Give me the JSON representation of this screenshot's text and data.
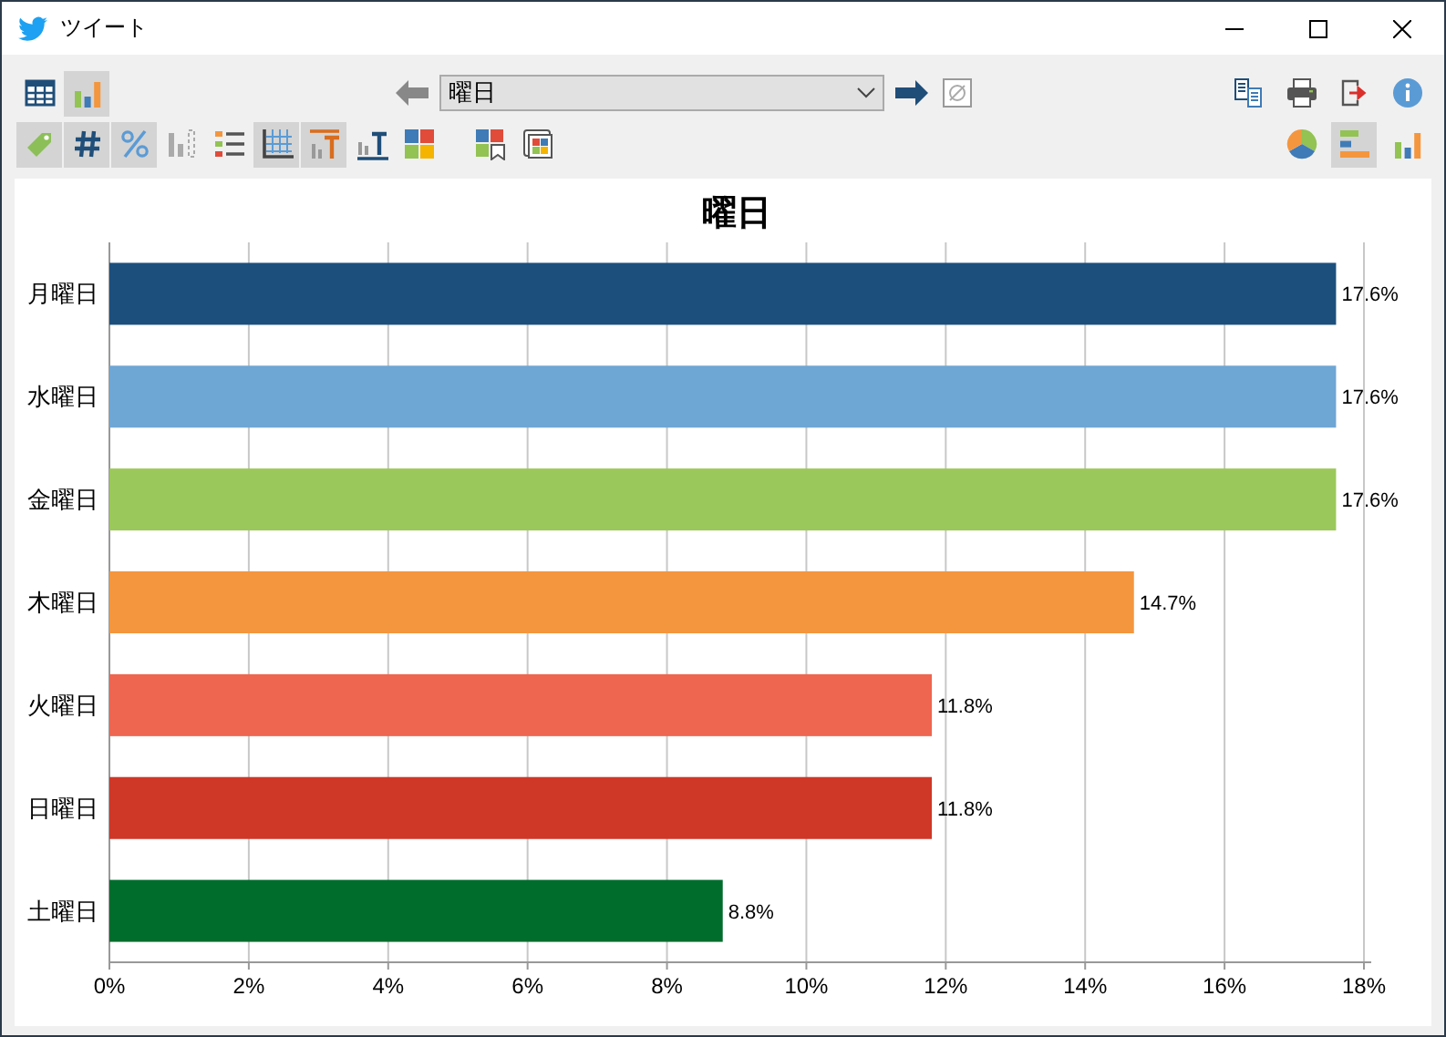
{
  "window": {
    "title": "ツイート"
  },
  "toolbar_top_left": [
    {
      "kind": "table",
      "selected": false
    },
    {
      "kind": "columns",
      "selected": true
    }
  ],
  "navigator": {
    "value": "曜日",
    "next_enabled": true,
    "prev_enabled": false
  },
  "toolbar_top_right": [
    {
      "kind": "copy",
      "selected": false
    },
    {
      "kind": "print",
      "selected": false
    },
    {
      "kind": "export",
      "selected": false
    },
    {
      "kind": "info",
      "selected": false
    }
  ],
  "toolbar_bottom_left": [
    {
      "kind": "tag",
      "selected": true
    },
    {
      "kind": "hash",
      "selected": true
    },
    {
      "kind": "percent",
      "selected": true
    },
    {
      "kind": "hidden",
      "selected": false
    },
    {
      "kind": "legend",
      "selected": false
    },
    {
      "kind": "grid",
      "selected": true
    },
    {
      "kind": "toplabel",
      "selected": true
    },
    {
      "kind": "axislabel",
      "selected": false
    },
    {
      "kind": "palette",
      "selected": false
    }
  ],
  "toolbar_bottom_palette": [
    {
      "kind": "palettemark",
      "selected": false
    },
    {
      "kind": "palettewin",
      "selected": false
    }
  ],
  "toolbar_bottom_right": [
    {
      "kind": "pie",
      "selected": false
    },
    {
      "kind": "hbar",
      "selected": true
    },
    {
      "kind": "columns",
      "selected": false
    }
  ],
  "chart": {
    "chart_data": {
      "type": "bar",
      "orientation": "horizontal",
      "title": "曜日",
      "categories": [
        "月曜日",
        "水曜日",
        "金曜日",
        "木曜日",
        "火曜日",
        "日曜日",
        "土曜日"
      ],
      "colors": [
        "#1c4f7c",
        "#6ea6d4",
        "#9bc85a",
        "#f4963e",
        "#ee6550",
        "#cf3727",
        "#016d2c"
      ],
      "values": [
        17.6,
        17.6,
        17.6,
        14.7,
        11.8,
        11.8,
        8.8
      ],
      "grid": true,
      "value_labels": [
        "17.6%",
        "17.6%",
        "17.6%",
        "14.7%",
        "11.8%",
        "11.8%",
        "8.8%"
      ],
      "xlim": [
        0,
        18
      ],
      "xticks": [
        {
          "value": 0,
          "label": "0%"
        },
        {
          "value": 2,
          "label": "2%"
        },
        {
          "value": 4,
          "label": "4%"
        },
        {
          "value": 6,
          "label": "6%"
        },
        {
          "value": 8,
          "label": "8%"
        },
        {
          "value": 10,
          "label": "10%"
        },
        {
          "value": 12,
          "label": "12%"
        },
        {
          "value": 14,
          "label": "14%"
        },
        {
          "value": 16,
          "label": "16%"
        },
        {
          "value": 18,
          "label": "18%"
        }
      ]
    }
  }
}
